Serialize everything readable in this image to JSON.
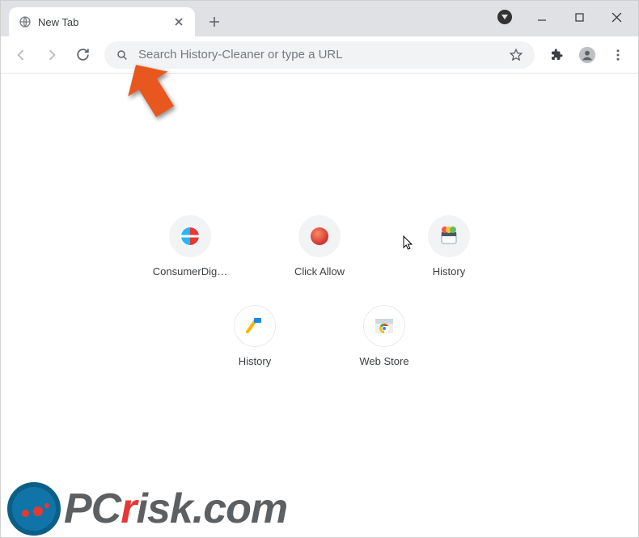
{
  "tab": {
    "title": "New Tab"
  },
  "omnibox": {
    "placeholder": "Search History-Cleaner or type a URL"
  },
  "shortcuts": {
    "row1": [
      {
        "label": "ConsumerDig…"
      },
      {
        "label": "Click Allow"
      },
      {
        "label": "History"
      }
    ],
    "row2": [
      {
        "label": "History"
      },
      {
        "label": "Web Store"
      }
    ]
  },
  "watermark": {
    "text_prefix": "PC",
    "text_r": "r",
    "text_suffix": "isk.com"
  }
}
